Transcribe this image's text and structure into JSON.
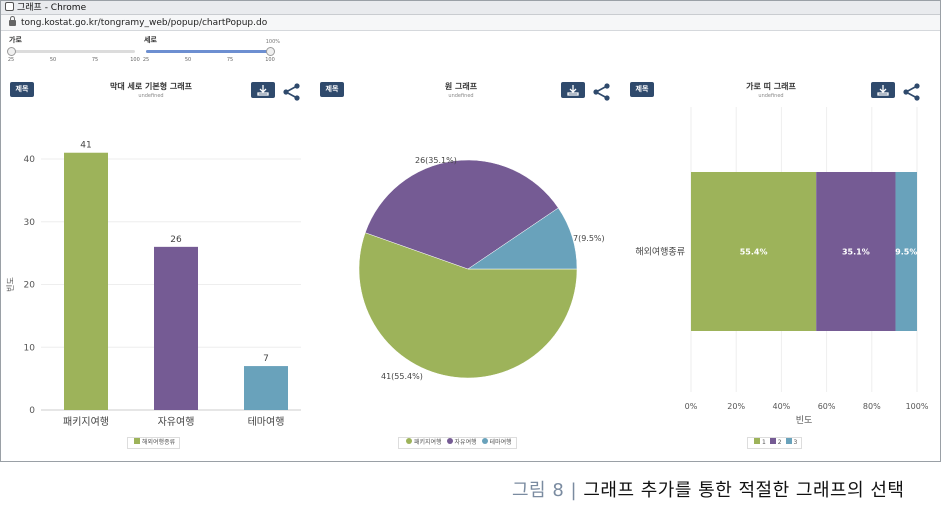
{
  "window": {
    "title": "그래프 - Chrome",
    "url": "tong.kostat.go.kr/tongramy_web/popup/chartPopup.do"
  },
  "sliders": [
    {
      "label": "가로",
      "max_label": "",
      "ticks": [
        "25",
        "50",
        "75",
        "100"
      ],
      "value": 0
    },
    {
      "label": "세로",
      "max_label": "100%",
      "ticks": [
        "25",
        "50",
        "75",
        "100"
      ],
      "value": 1.0
    }
  ],
  "panels": [
    {
      "title_button": "제목",
      "title": "막대 세로 기본형 그래프",
      "subtitle": "undefined"
    },
    {
      "title_button": "제목",
      "title": "원 그래프",
      "subtitle": "undefined"
    },
    {
      "title_button": "제목",
      "title": "가로 띠 그래프",
      "subtitle": "undefined"
    }
  ],
  "colors": {
    "green": "#9db35a",
    "purple": "#755b94",
    "blue": "#69a2bb",
    "button": "#2f4a6c"
  },
  "chart_data": [
    {
      "type": "bar",
      "categories": [
        "패키지여행",
        "자유여행",
        "테마여행"
      ],
      "values": [
        41,
        26,
        7
      ],
      "data_labels": [
        "41",
        "26",
        "7"
      ],
      "ylabel": "빈도",
      "ylim": [
        0,
        40
      ],
      "yticks": [
        "0",
        "10",
        "20",
        "30",
        "40"
      ],
      "legend": [
        "해외여행종류"
      ],
      "grid": true
    },
    {
      "type": "pie",
      "categories": [
        "패키지여행",
        "자유여행",
        "테마여행"
      ],
      "values": [
        41,
        26,
        7
      ],
      "data_labels": [
        "41(55.4%)",
        "26(35.1%)",
        "7(9.5%)"
      ],
      "legend": [
        "패키지여행",
        "자유여행",
        "테마여행"
      ]
    },
    {
      "type": "bar",
      "orientation": "horizontal-stacked-100",
      "categories": [
        "해외여행종류"
      ],
      "series": [
        {
          "name": "1",
          "values": [
            55.4
          ]
        },
        {
          "name": "2",
          "values": [
            35.1
          ]
        },
        {
          "name": "3",
          "values": [
            9.5
          ]
        }
      ],
      "data_labels": [
        "55.4%",
        "35.1%",
        "9.5%"
      ],
      "xlabel": "빈도",
      "xticks": [
        "0%",
        "20%",
        "40%",
        "60%",
        "80%",
        "100%"
      ],
      "xlim": [
        0,
        100
      ],
      "legend": [
        "1",
        "2",
        "3"
      ],
      "grid": true
    }
  ],
  "caption": {
    "figure": "그림 8",
    "separator": "|",
    "text": "그래프 추가를 통한 적절한 그래프의 선택"
  }
}
